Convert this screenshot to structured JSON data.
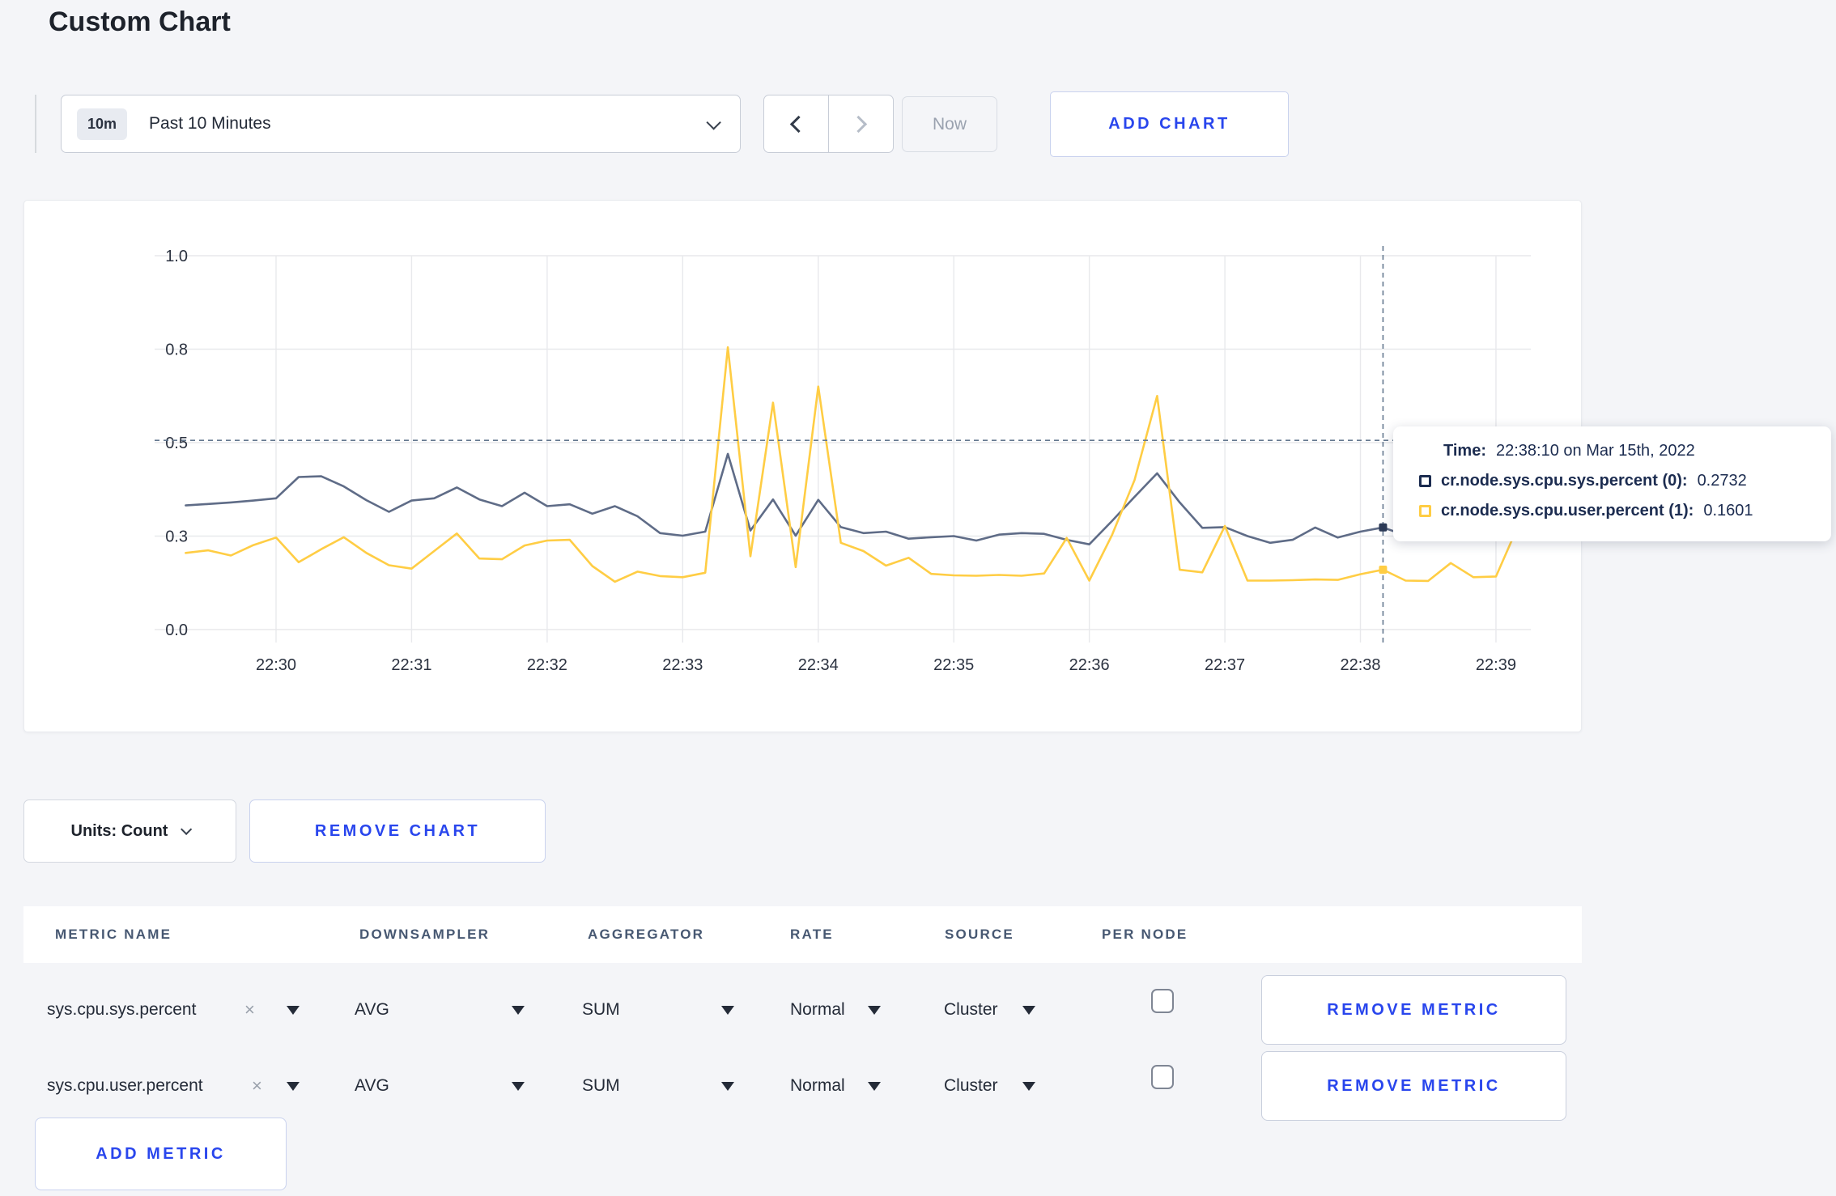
{
  "title": "Custom Chart",
  "toolbar": {
    "time_badge": "10m",
    "time_label": "Past 10 Minutes",
    "now_label": "Now",
    "add_chart_label": "ADD CHART"
  },
  "chart_controls": {
    "units_label": "Units: Count",
    "remove_chart_label": "REMOVE CHART"
  },
  "tooltip": {
    "time_label": "Time:",
    "time_value": "22:38:10 on Mar 15th, 2022",
    "series": [
      {
        "name": "cr.node.sys.cpu.sys.percent (0):",
        "value": "0.2732"
      },
      {
        "name": "cr.node.sys.cpu.user.percent (1):",
        "value": "0.1601"
      }
    ]
  },
  "chart_data": {
    "type": "line",
    "title": "",
    "xlabel": "",
    "ylabel": "",
    "ylim": [
      0,
      1
    ],
    "grid": true,
    "legend_position": "tooltip-only",
    "x_ticks": [
      "22:30",
      "22:31",
      "22:32",
      "22:33",
      "22:34",
      "22:35",
      "22:36",
      "22:37",
      "22:38",
      "22:39"
    ],
    "y_tick_labels": [
      "0.0",
      "0.3",
      "0.5",
      "0.8",
      "1.0"
    ],
    "y_tick_values": [
      0,
      0.25,
      0.5,
      0.75,
      1.0
    ],
    "x_start_time": "22:29:20",
    "x_step_seconds": 10,
    "start_offset_seconds_before_first_tick": 40,
    "series": [
      {
        "name": "cr.node.sys.cpu.sys.percent",
        "color": "#5f6c87",
        "values": [
          0.332,
          0.336,
          0.34,
          0.345,
          0.351,
          0.408,
          0.41,
          0.383,
          0.346,
          0.315,
          0.345,
          0.351,
          0.38,
          0.348,
          0.33,
          0.366,
          0.33,
          0.335,
          0.31,
          0.33,
          0.303,
          0.258,
          0.251,
          0.262,
          0.47,
          0.265,
          0.348,
          0.251,
          0.347,
          0.274,
          0.258,
          0.262,
          0.243,
          0.247,
          0.25,
          0.238,
          0.254,
          0.258,
          0.256,
          0.24,
          0.228,
          0.29,
          0.355,
          0.418,
          0.34,
          0.272,
          0.274,
          0.25,
          0.232,
          0.24,
          0.273,
          0.246,
          0.262,
          0.2732,
          0.252,
          0.257,
          0.262,
          0.25,
          0.268,
          0.3
        ]
      },
      {
        "name": "cr.node.sys.cpu.user.percent",
        "color": "#ffcd44",
        "values": [
          0.205,
          0.212,
          0.198,
          0.226,
          0.246,
          0.18,
          0.215,
          0.247,
          0.205,
          0.172,
          0.163,
          0.21,
          0.257,
          0.19,
          0.188,
          0.225,
          0.238,
          0.24,
          0.17,
          0.128,
          0.155,
          0.143,
          0.14,
          0.152,
          0.755,
          0.196,
          0.607,
          0.167,
          0.65,
          0.232,
          0.21,
          0.171,
          0.192,
          0.149,
          0.145,
          0.144,
          0.146,
          0.144,
          0.15,
          0.245,
          0.131,
          0.252,
          0.4,
          0.625,
          0.16,
          0.153,
          0.277,
          0.131,
          0.131,
          0.132,
          0.134,
          0.133,
          0.148,
          0.1601,
          0.131,
          0.13,
          0.178,
          0.14,
          0.142,
          0.28
        ]
      }
    ],
    "crosshair": {
      "time": "22:38:10",
      "point_index": 53,
      "hline_value": 0.506,
      "color": "#64788f",
      "marker_values": [
        0.2732,
        0.1601
      ]
    }
  },
  "metrics_table": {
    "headers": [
      "METRIC NAME",
      "DOWNSAMPLER",
      "AGGREGATOR",
      "RATE",
      "SOURCE",
      "PER NODE"
    ],
    "rows": [
      {
        "metric": "sys.cpu.sys.percent",
        "remove": "×",
        "downsampler": "AVG",
        "aggregator": "SUM",
        "rate": "Normal",
        "source": "Cluster",
        "per_node_checked": false,
        "remove_metric_label": "REMOVE METRIC"
      },
      {
        "metric": "sys.cpu.user.percent",
        "remove": "×",
        "downsampler": "AVG",
        "aggregator": "SUM",
        "rate": "Normal",
        "source": "Cluster",
        "per_node_checked": false,
        "remove_metric_label": "REMOVE METRIC"
      }
    ],
    "add_metric_label": "ADD METRIC"
  }
}
